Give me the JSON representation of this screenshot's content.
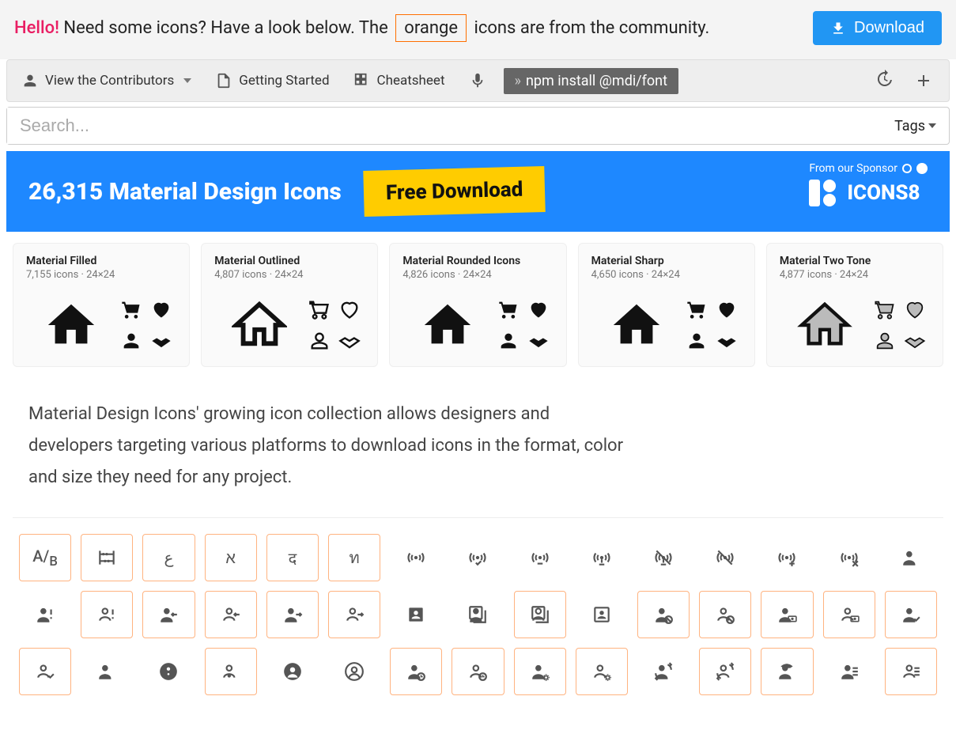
{
  "banner": {
    "hello": "Hello!",
    "text1": " Need some icons? Have a look below. The ",
    "orange": "orange",
    "text2": " icons are from the community.",
    "download": "Download"
  },
  "toolbar": {
    "contributors": "View the Contributors",
    "getting_started": "Getting Started",
    "cheatsheet": "Cheatsheet",
    "npm": "npm install @mdi/font"
  },
  "search": {
    "placeholder": "Search...",
    "tags": "Tags"
  },
  "sponsor": {
    "title": "26,315 Material Design Icons",
    "free": "Free Download",
    "from": "From our Sponsor",
    "brand": "ICONS8"
  },
  "cards": [
    {
      "title": "Material Filled",
      "sub": "7,155 icons · 24×24"
    },
    {
      "title": "Material Outlined",
      "sub": "4,807 icons · 24×24"
    },
    {
      "title": "Material Rounded Icons",
      "sub": "4,826 icons · 24×24"
    },
    {
      "title": "Material Sharp",
      "sub": "4,650 icons · 24×24"
    },
    {
      "title": "Material Two Tone",
      "sub": "4,877 icons · 24×24"
    }
  ],
  "description": "Material Design Icons' growing icon collection allows designers and developers targeting various platforms to download icons in the format, color and size they need for any project.",
  "grid": [
    [
      {
        "name": "ab-testing",
        "c": true
      },
      {
        "name": "abacus",
        "c": true
      },
      {
        "name": "abjad-arabic",
        "c": true
      },
      {
        "name": "abjad-hebrew",
        "c": true
      },
      {
        "name": "abugida-devanagari",
        "c": true
      },
      {
        "name": "abugida-thai",
        "c": true
      },
      {
        "name": "access-point",
        "c": false
      },
      {
        "name": "access-point-check",
        "c": false
      },
      {
        "name": "access-point-minus",
        "c": false
      },
      {
        "name": "access-point-network",
        "c": false
      },
      {
        "name": "access-point-network-off",
        "c": false
      },
      {
        "name": "access-point-off",
        "c": false
      },
      {
        "name": "access-point-plus",
        "c": false
      },
      {
        "name": "access-point-remove",
        "c": false
      },
      {
        "name": "account",
        "c": false
      }
    ],
    [
      {
        "name": "account-alert",
        "c": false
      },
      {
        "name": "account-alert-outline",
        "c": true
      },
      {
        "name": "account-arrow-left",
        "c": true
      },
      {
        "name": "account-arrow-left-outline",
        "c": true
      },
      {
        "name": "account-arrow-right",
        "c": true
      },
      {
        "name": "account-arrow-right-outline",
        "c": true
      },
      {
        "name": "account-box",
        "c": false
      },
      {
        "name": "account-box-multiple",
        "c": false
      },
      {
        "name": "account-box-multiple-outline",
        "c": true
      },
      {
        "name": "account-box-outline",
        "c": false
      },
      {
        "name": "account-cancel",
        "c": true
      },
      {
        "name": "account-cancel-outline",
        "c": true
      },
      {
        "name": "account-cash",
        "c": true
      },
      {
        "name": "account-cash-outline",
        "c": true
      },
      {
        "name": "account-check",
        "c": true
      }
    ],
    [
      {
        "name": "account-check-outline",
        "c": true
      },
      {
        "name": "account-child",
        "c": false
      },
      {
        "name": "account-child-circle",
        "c": false
      },
      {
        "name": "account-child-outline",
        "c": true
      },
      {
        "name": "account-circle",
        "c": false
      },
      {
        "name": "account-circle-outline",
        "c": false
      },
      {
        "name": "account-clock",
        "c": true
      },
      {
        "name": "account-clock-outline",
        "c": true
      },
      {
        "name": "account-cog",
        "c": true
      },
      {
        "name": "account-cog-outline",
        "c": true
      },
      {
        "name": "account-convert",
        "c": false
      },
      {
        "name": "account-convert-outline",
        "c": true
      },
      {
        "name": "account-cowboy-hat",
        "c": true
      },
      {
        "name": "account-details",
        "c": false
      },
      {
        "name": "account-details-outline",
        "c": true
      }
    ]
  ]
}
